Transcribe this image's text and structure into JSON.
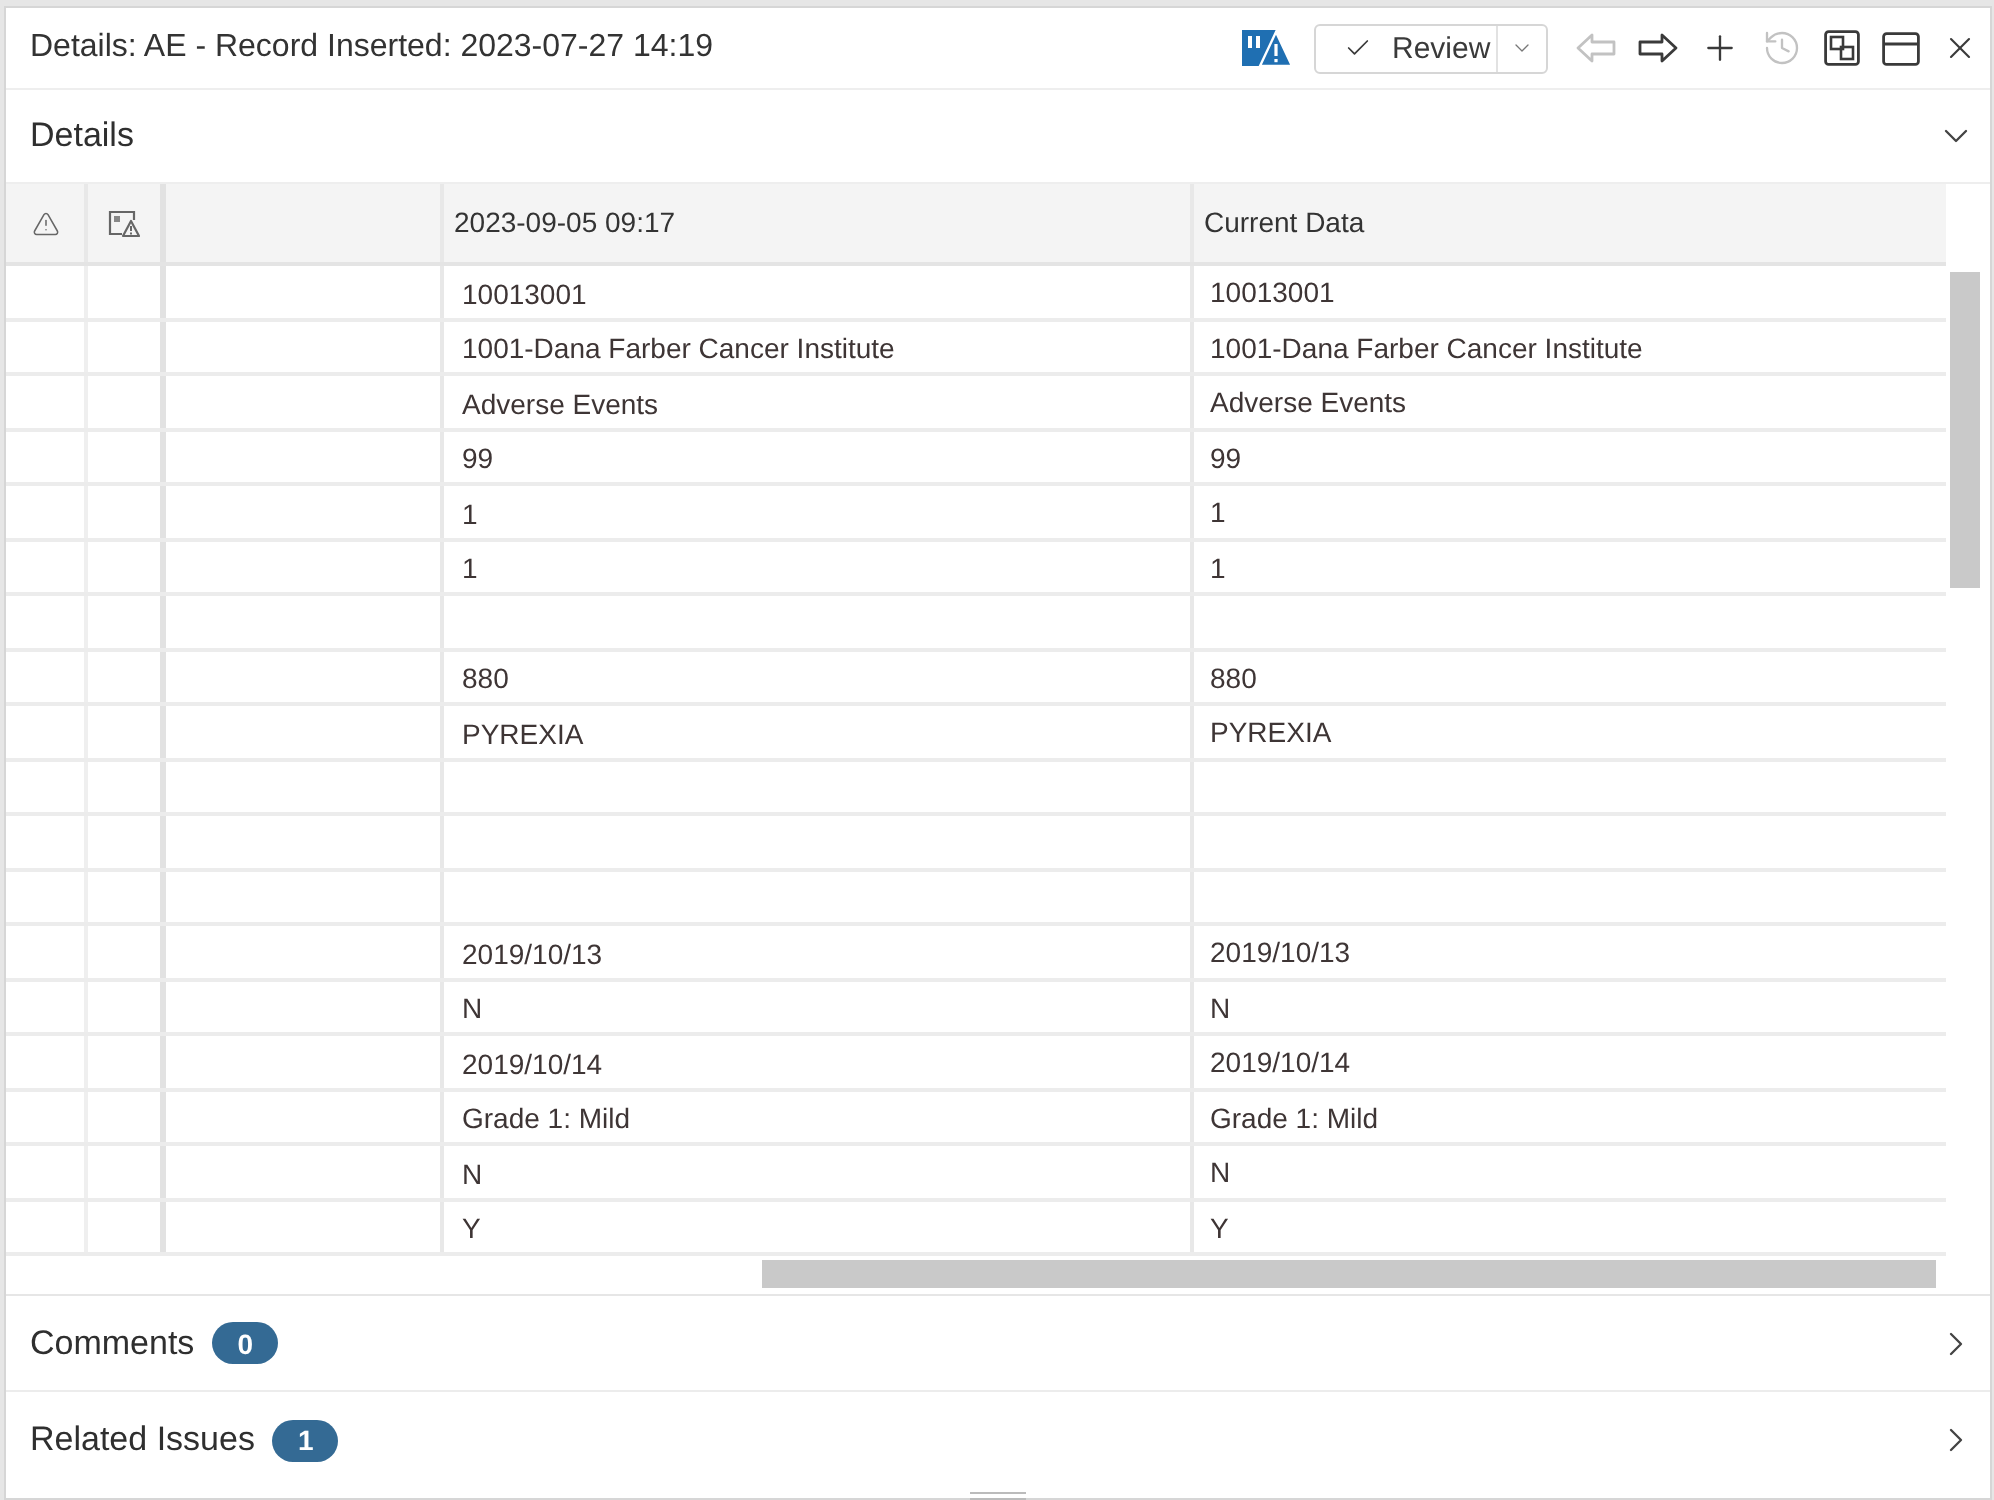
{
  "window": {
    "title": "Details: AE - Record Inserted: 2023-07-27 14:19"
  },
  "toolbar": {
    "items": [
      {
        "kind": "flag",
        "disabled": false
      },
      {
        "kind": "review",
        "label": "Review",
        "disabled": false
      },
      {
        "kind": "back",
        "disabled": true
      },
      {
        "kind": "forward",
        "disabled": false
      },
      {
        "kind": "add",
        "disabled": false
      },
      {
        "kind": "history",
        "disabled": true
      },
      {
        "kind": "layout",
        "disabled": false
      },
      {
        "kind": "window",
        "disabled": false
      },
      {
        "kind": "close",
        "disabled": false
      }
    ]
  },
  "details": {
    "title": "Details",
    "expanded": true,
    "table": {
      "columns": [
        {
          "label": "2023-09-05 09:17"
        },
        {
          "label": "Current Data"
        }
      ],
      "rows": [
        {
          "dated": "10013001",
          "current": "10013001"
        },
        {
          "dated": "1001-Dana Farber Cancer Institute",
          "current": "1001-Dana Farber Cancer Institute"
        },
        {
          "dated": "Adverse Events",
          "current": "Adverse Events"
        },
        {
          "dated": "99",
          "current": "99"
        },
        {
          "dated": "1",
          "current": "1"
        },
        {
          "dated": "1",
          "current": "1"
        },
        {},
        {
          "dated": "880",
          "current": "880"
        },
        {
          "dated": "PYREXIA",
          "current": "PYREXIA"
        },
        {},
        {},
        {},
        {
          "dated": "2019/10/13",
          "current": "2019/10/13"
        },
        {
          "dated": "N",
          "current": "N"
        },
        {
          "dated": "2019/10/14",
          "current": "2019/10/14"
        },
        {
          "dated": "Grade 1: Mild",
          "current": "Grade 1: Mild"
        },
        {
          "dated": "N",
          "current": "N"
        },
        {
          "dated": "Y",
          "current": "Y"
        }
      ]
    }
  },
  "sections": [
    {
      "title": "Comments",
      "count": "0",
      "expanded": false
    },
    {
      "title": "Related Issues",
      "count": "1",
      "expanded": false
    }
  ]
}
